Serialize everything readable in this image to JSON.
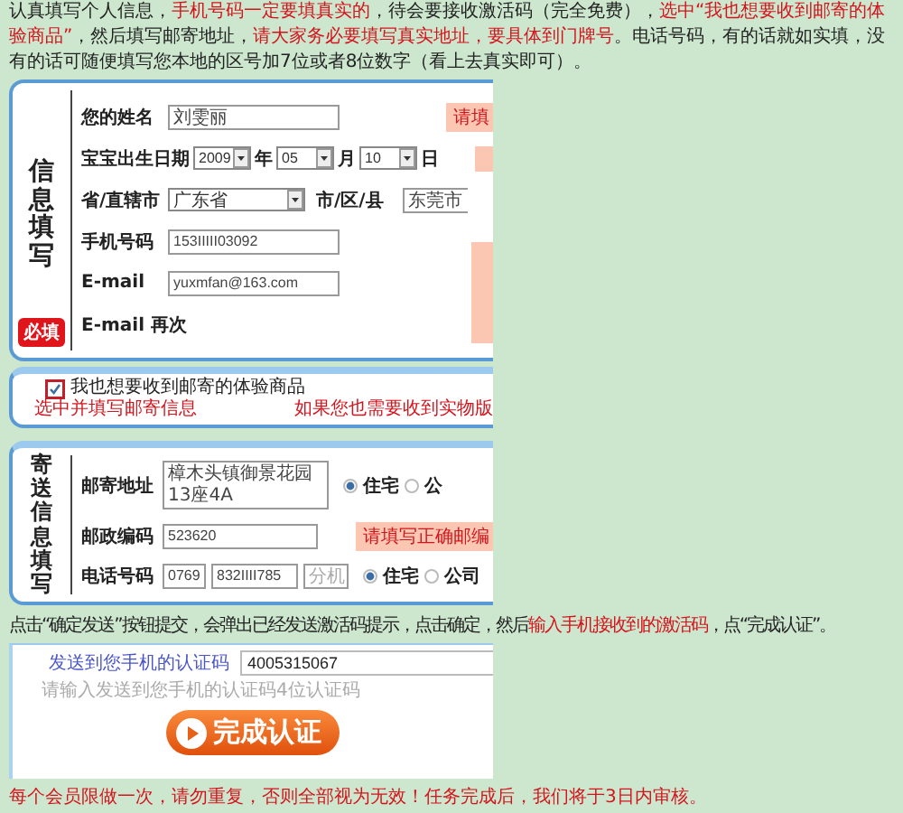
{
  "intro": [
    {
      "text": "认真填写个人信息，",
      "emphasis": false
    },
    {
      "text": "手机号码一定要填真实的",
      "emphasis": true
    },
    {
      "text": "，待会要接收激活码（完全免费），",
      "emphasis": false
    },
    {
      "text": "选中“我也想要收到邮寄的体验商品”",
      "emphasis": true
    },
    {
      "text": "，然后填写邮寄地址，",
      "emphasis": false
    },
    {
      "text": "请大家务必要填写真实地址，要具体到门牌号",
      "emphasis": true
    },
    {
      "text": "。电话号码，有的话就如实填，没有的话可随便填写您本地的区号加7位或者8位数字（看上去真实即可）。",
      "emphasis": false
    }
  ],
  "info_form": {
    "heading": "信息填写",
    "badge": "必填",
    "side_bubble": true,
    "fields": [
      {
        "label": "您的姓名",
        "kind": "text",
        "value": "刘雯丽",
        "tip": "请填"
      },
      {
        "label": "宝宝出生日期",
        "kind": "date",
        "bubble": true,
        "parts": [
          {
            "value": "2009",
            "unit": "年"
          },
          {
            "value": "05",
            "unit": "月"
          },
          {
            "value": "10",
            "unit": "日"
          }
        ]
      },
      {
        "label": "省/直辖市",
        "kind": "region",
        "value": "广东省",
        "label_2": "市/区/县",
        "value_2": "东莞市"
      },
      {
        "label": "手机号码",
        "kind": "text",
        "value": "153IIIII03092"
      },
      {
        "label": "E-mail",
        "kind": "text",
        "value": "yuxmfan@163.com"
      },
      {
        "label": "E-mail 再次",
        "kind": "empty"
      }
    ]
  },
  "optin": {
    "checked": true,
    "label": "我也想要收到邮寄的体验商品",
    "note": "选中并填写邮寄信息",
    "side_note": "如果您也需要收到实物版"
  },
  "shipping": {
    "heading": "寄送信息填写",
    "rows": [
      {
        "label": "邮寄地址",
        "kind": "textarea",
        "value": "樟木头镇御景花园13座4A",
        "options": [
          {
            "label": "住宅",
            "selected": true
          },
          {
            "label": "公",
            "selected": false
          }
        ]
      },
      {
        "label": "邮政编码",
        "kind": "text",
        "value": "523620",
        "tip": "请填写正确邮编"
      },
      {
        "label": "电话号码",
        "kind": "phone",
        "parts": [
          {
            "value": "0769"
          },
          {
            "value": "832IIII785"
          },
          {
            "placeholder": "分机"
          }
        ],
        "options": [
          {
            "label": "住宅",
            "selected": true
          },
          {
            "label": "公司",
            "selected": false
          }
        ]
      }
    ]
  },
  "step": [
    {
      "text": "点击“确定发送”按钮提交，会弹出已经发送激活码提示，点击确定，然后",
      "emphasis": false
    },
    {
      "text": "输入手机接收到的激活码",
      "emphasis": true
    },
    {
      "text": "，点“完成认证”。",
      "emphasis": false
    }
  ],
  "verify": {
    "label": "发送到您手机的认证码",
    "value": "4005315067",
    "hint": "请输入发送到您手机的认证码4位认证码",
    "button": "完成认证"
  },
  "notice": "每个会员限做一次，请勿重复，否则全部视为无效！任务完成后，我们将于3日内审核。"
}
